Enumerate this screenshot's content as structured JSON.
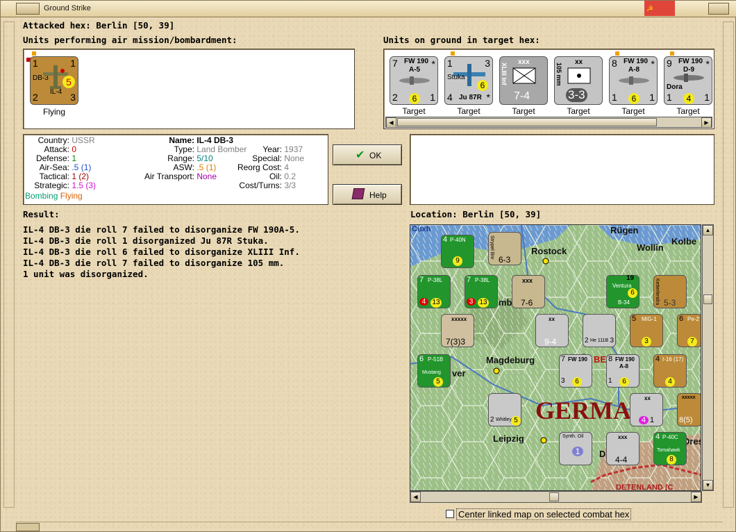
{
  "window": {
    "title": "Ground Strike"
  },
  "header": {
    "attacked_hex": "Attacked hex: Berlin  [50, 39]"
  },
  "air_panel": {
    "label": "Units performing air mission/bombardment:",
    "unit": {
      "top_left": "1",
      "top_right": "1",
      "name": "DB-3",
      "type_label": "IL-4",
      "bottom_left": "2",
      "bottom_right": "3",
      "value": "5",
      "status": "Flying"
    }
  },
  "ground_panel": {
    "label": "Units on ground in target hex:",
    "units": [
      {
        "tl": "7",
        "name": "FW 190",
        "sub": "A-5",
        "bl": "2",
        "mid": "6",
        "br": "1",
        "star": "*",
        "caption": "Target"
      },
      {
        "tl": "1",
        "name": "Stuka",
        "sub": "Ju 87R",
        "bl": "4",
        "mid": "6",
        "tr": "3",
        "star": "*",
        "caption": "Target"
      },
      {
        "name": "xxx",
        "side": "XLIII Inf",
        "value": "7-4",
        "caption": "Target"
      },
      {
        "name": "xx",
        "side": "105 mm",
        "value": "3-3",
        "caption": "Target"
      },
      {
        "tl": "8",
        "name": "FW 190",
        "sub": "A-8",
        "bl": "1",
        "mid": "6",
        "br": "1",
        "star": "*",
        "caption": "Target"
      },
      {
        "tl": "9",
        "name": "FW 190",
        "sub": "D-9",
        "extra": "Dora",
        "bl": "1",
        "mid": "4",
        "br": "1",
        "star": "*",
        "caption": "Target"
      }
    ]
  },
  "info": {
    "country_label": "Country:",
    "country": "USSR",
    "attack_label": "Attack:",
    "attack": "0",
    "defense_label": "Defense:",
    "defense": "1",
    "airsea_label": "Air-Sea:",
    "airsea_a": ".5",
    "airsea_b": "(1)",
    "tactical_label": "Tactical:",
    "tactical_a": "1",
    "tactical_b": "(2)",
    "strategic_label": "Strategic:",
    "strategic_a": "1.5",
    "strategic_b": "(3)",
    "bombing": "Bombing",
    "flying": "Flying",
    "name_label": "Name:",
    "name": "IL-4 DB-3",
    "type_label": "Type:",
    "type": "Land Bomber",
    "range_label": "Range:",
    "range": "5/10",
    "asw_label": "ASW:",
    "asw_a": ".5",
    "asw_b": "(1)",
    "airtransport_label": "Air Transport:",
    "airtransport": "None",
    "year_label": "Year:",
    "year": "1937",
    "special_label": "Special:",
    "special": "None",
    "reorg_label": "Reorg Cost:",
    "reorg": "4",
    "oil_label": "Oil:",
    "oil": "0.2",
    "costturns_label": "Cost/Turns:",
    "costturns": "3/3"
  },
  "buttons": {
    "ok": "OK",
    "help": "Help"
  },
  "result": {
    "label": "Result:",
    "lines": [
      "IL-4 DB-3 die roll 7 failed to disorganize FW 190A-5.",
      "IL-4 DB-3 die roll 1 disorganized Ju 87R Stuka.",
      "IL-4 DB-3 die roll 6 failed to disorganize XLIII Inf.",
      "IL-4 DB-3 die roll 7 failed to disorganize 105 mm.",
      "1 unit was disorganized."
    ]
  },
  "location": {
    "label": "Location:  Berlin  [50, 39]",
    "map_labels": [
      "Rügen",
      "Rostock",
      "Wollin",
      "Kolbe",
      "Magdeburg",
      "GERMA",
      "Leipzig",
      "Dres",
      "DETENLAND (C",
      "Cuxh",
      "mb",
      "ver",
      "D",
      "BE"
    ],
    "counters": [
      {
        "tl": "4",
        "name": "P-40N",
        "bot": "9"
      },
      {
        "name": "Strypel Bnr",
        "val": "6-3"
      },
      {
        "tl": "7",
        "name": "P-38L",
        "a": "4",
        "b": "13"
      },
      {
        "tl": "7",
        "name": "P-38L",
        "a": "3",
        "b": "13"
      },
      {
        "name": "xxx",
        "val": "7-6"
      },
      {
        "name": "19",
        "sub": "Ventura",
        "a": "6",
        "b": "B-34"
      },
      {
        "name": "Ketterlendra",
        "val": "5-3"
      },
      {
        "name": "xxxxx",
        "val": "7(3)3"
      },
      {
        "name": "xx",
        "val": "9-4"
      },
      {
        "tl": "2",
        "name": "He 111B",
        "bot": "3"
      },
      {
        "tl": "5",
        "name": "MiG-1",
        "bot": "3"
      },
      {
        "tl": "6",
        "name": "Pe-2",
        "bot": "7"
      },
      {
        "tl": "6",
        "name": "P-51B",
        "sub": "Mustang",
        "bot": "5"
      },
      {
        "tl": "7",
        "name": "FW 190",
        "a": "3",
        "b": "6"
      },
      {
        "tl": "8",
        "name": "FW 190",
        "sub": "A-8",
        "a": "1",
        "b": "6"
      },
      {
        "tl": "4",
        "name": "I-16 (17)",
        "bot": "4"
      },
      {
        "tl": "2",
        "name": "Whitley",
        "bot": "5"
      },
      {
        "name": "xx",
        "val": "4",
        "sub": "1"
      },
      {
        "name": "xxxxx",
        "val": "8(5)"
      },
      {
        "name": "Synth. Oil",
        "val": "1"
      },
      {
        "name": "xxx",
        "val": "4-4"
      },
      {
        "tl": "4",
        "name": "P-40C",
        "sub": "Tomahawk",
        "bot": "8"
      }
    ]
  },
  "footer": {
    "checkbox_label": "Center linked map on selected combat hex"
  },
  "colors": {
    "country": "#7f7f7f",
    "attack": "#d40000",
    "defense": "#008a00",
    "airsea": "#2050d0",
    "tactical": "#a00000",
    "strategic": "#d010d0",
    "bombing": "#00a070",
    "flying": "#d86000",
    "range": "#008080",
    "asw": "#e08000",
    "airtransport": "#a000a0",
    "gray": "#7f7f7f"
  }
}
